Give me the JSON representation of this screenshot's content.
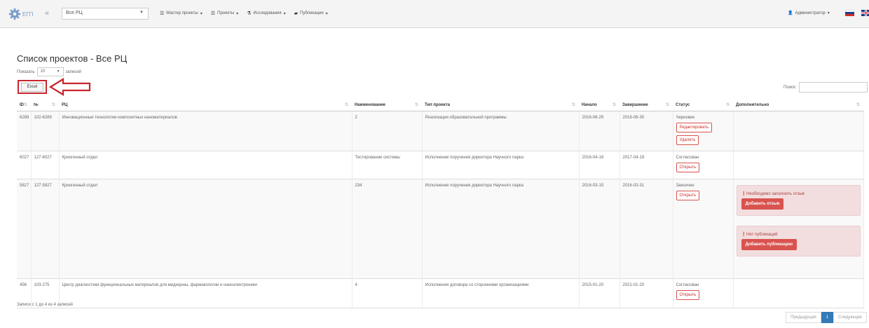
{
  "navbar": {
    "logo_text": "ЕГП",
    "collapse_icon": "«",
    "rc_select_value": "Все РЦ",
    "menu": [
      {
        "icon": "list-icon",
        "label": "Мастер проекты"
      },
      {
        "icon": "list-icon",
        "label": "Проекты"
      },
      {
        "icon": "flask-icon",
        "label": "Исследования"
      },
      {
        "icon": "book-icon",
        "label": "Публикации"
      }
    ],
    "user_label": "Администратор"
  },
  "page": {
    "title": "Список проектов - Все РЦ",
    "length_prefix": "Показать",
    "length_value": "10",
    "length_suffix": "записей",
    "excel_label": "Excel",
    "search_label": "Поиск:",
    "search_value": ""
  },
  "table": {
    "headers": [
      "ID",
      "№",
      "РЦ",
      "Наименование",
      "Тип проекта",
      "Начало",
      "Завершение",
      "Статус",
      "Дополнительно"
    ],
    "rows": [
      {
        "id": "6289",
        "num": "102-6289",
        "rc": "Инновационные технологии композитных наноматериалов",
        "name": "2",
        "type": "Реализация образовательной программы",
        "start": "2016-06-29",
        "end": "2016-06-30",
        "status": "Черновик",
        "actions": [
          "Редактировать",
          "Удалить"
        ],
        "alerts": []
      },
      {
        "id": "6027",
        "num": "127-6027",
        "rc": "Криогенный отдел",
        "name": "Тестирование системы",
        "type": "Исполнение поручения директора Научного парка",
        "start": "2016-04-18",
        "end": "2017-04-19",
        "status": "Согласован",
        "actions": [
          "Открыть"
        ],
        "alerts": []
      },
      {
        "id": "5827",
        "num": "127-5827",
        "rc": "Криогенный отдел",
        "name": "234",
        "type": "Исполнение поручения директора Научного парка",
        "start": "2016-03-15",
        "end": "2016-03-31",
        "status": "Закончен",
        "actions": [
          "Открыть"
        ],
        "alerts": [
          {
            "text": "Необходимо заполнить отзыв",
            "button": "Добавить отзыв"
          },
          {
            "text": "Нет публикаций",
            "button": "Добавить публикацию"
          }
        ]
      },
      {
        "id": "456",
        "num": "103-275",
        "rc": "Центр диагностики функциональных материалов для медицины, фармакологии и наноэлектроники",
        "name": "4",
        "type": "Исполнения договора со сторонними организациями",
        "start": "2015-01-20",
        "end": "2021-01-20",
        "status": "Согласован",
        "actions": [
          "Открыть"
        ],
        "alerts": []
      }
    ]
  },
  "footer": {
    "info": "Записи с 1 до 4 из 4 записей",
    "prev_label": "Предыдущая",
    "current_page": "1",
    "next_label": "Следующая"
  },
  "colors": {
    "accent_red": "#d9534f",
    "highlight_red": "#c8252c",
    "alert_bg": "#f2dede",
    "pager_active": "#337ab7"
  }
}
